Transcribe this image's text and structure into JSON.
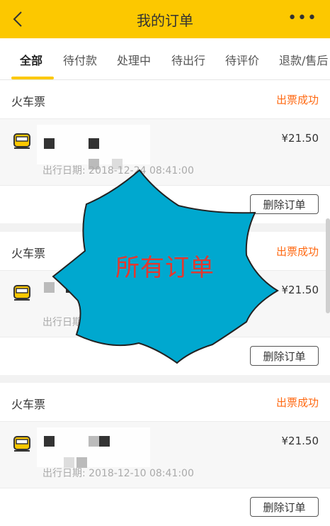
{
  "header": {
    "title": "我的订单",
    "more": "•••"
  },
  "tabs": [
    {
      "label": "全部",
      "active": true
    },
    {
      "label": "待付款"
    },
    {
      "label": "处理中"
    },
    {
      "label": "待出行"
    },
    {
      "label": "待评价"
    },
    {
      "label": "退款/售后"
    }
  ],
  "orders": [
    {
      "type": "火车票",
      "status": "出票成功",
      "price": "¥21.50",
      "date": "出行日期: 2018-12-24 08:41:00",
      "delete": "删除订单"
    },
    {
      "type": "火车票",
      "status": "出票成功",
      "price": "¥21.50",
      "date": "出行日期",
      "delete": "删除订单"
    },
    {
      "type": "火车票",
      "status": "出票成功",
      "price": "¥21.50",
      "date": "出行日期: 2018-12-10 08:41:00",
      "delete": "删除订单"
    }
  ],
  "overlay": {
    "label": "所有订单"
  },
  "colors": {
    "brand": "#fcc800",
    "status": "#ff6a13",
    "overlay_fill": "#00a8cf",
    "overlay_text": "#e6372d"
  }
}
